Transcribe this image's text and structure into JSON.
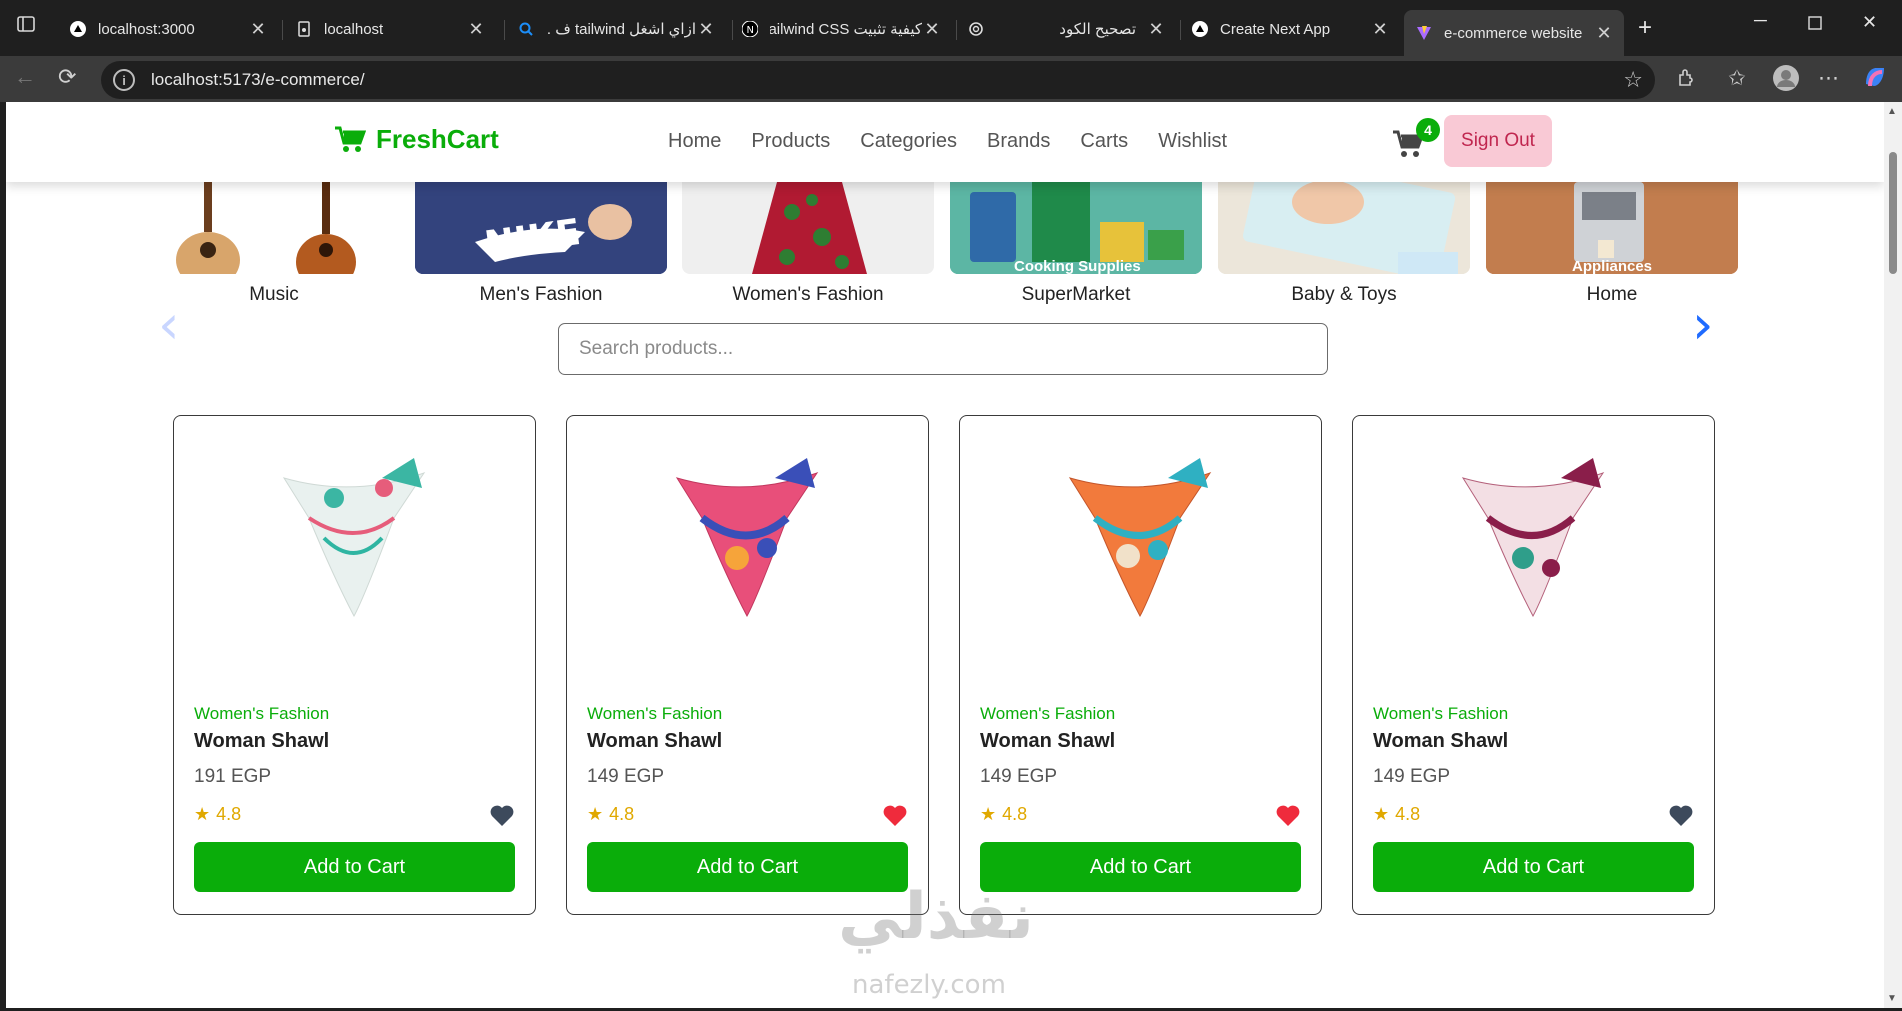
{
  "browser": {
    "tabs": [
      {
        "title": "localhost:3000",
        "icon": "triangle-icon"
      },
      {
        "title": "localhost",
        "icon": "page-icon"
      },
      {
        "title": "ازاي اشغل tailwind ف ...",
        "icon": "search-icon"
      },
      {
        "title": "كيفية تثبيت Tailwind CSS",
        "icon": "next-logo-icon"
      },
      {
        "title": "تصحيح الكود",
        "icon": "openai-icon"
      },
      {
        "title": "Create Next App",
        "icon": "triangle-icon"
      },
      {
        "title": "e-commerce website",
        "icon": "vite-icon"
      }
    ],
    "url": "localhost:5173/e-commerce/"
  },
  "header": {
    "brand": "FreshCart",
    "nav": [
      "Home",
      "Products",
      "Categories",
      "Brands",
      "Carts",
      "Wishlist"
    ],
    "cart_count": "4",
    "signout_label": "Sign Out",
    "brand_color": "#0aad0a"
  },
  "slider": {
    "slides": [
      {
        "label": "Music"
      },
      {
        "label": "Men's Fashion"
      },
      {
        "label": "Women's Fashion"
      },
      {
        "label": "SuperMarket",
        "overlay": "Cooking Supplies"
      },
      {
        "label": "Baby & Toys"
      },
      {
        "label": "Home",
        "overlay": "Appliances"
      }
    ],
    "dots": 5,
    "active_dot": 0
  },
  "search": {
    "placeholder": "Search products..."
  },
  "products": [
    {
      "category": "Women's Fashion",
      "name": "Woman Shawl",
      "price": "191 EGP",
      "rating": "4.8",
      "wishlisted": false,
      "button": "Add to Cart"
    },
    {
      "category": "Women's Fashion",
      "name": "Woman Shawl",
      "price": "149 EGP",
      "rating": "4.8",
      "wishlisted": true,
      "button": "Add to Cart"
    },
    {
      "category": "Women's Fashion",
      "name": "Woman Shawl",
      "price": "149 EGP",
      "rating": "4.8",
      "wishlisted": true,
      "button": "Add to Cart"
    },
    {
      "category": "Women's Fashion",
      "name": "Woman Shawl",
      "price": "149 EGP",
      "rating": "4.8",
      "wishlisted": false,
      "button": "Add to Cart"
    }
  ],
  "watermark": {
    "main": "نفذلي",
    "sub": "nafezly.com"
  }
}
